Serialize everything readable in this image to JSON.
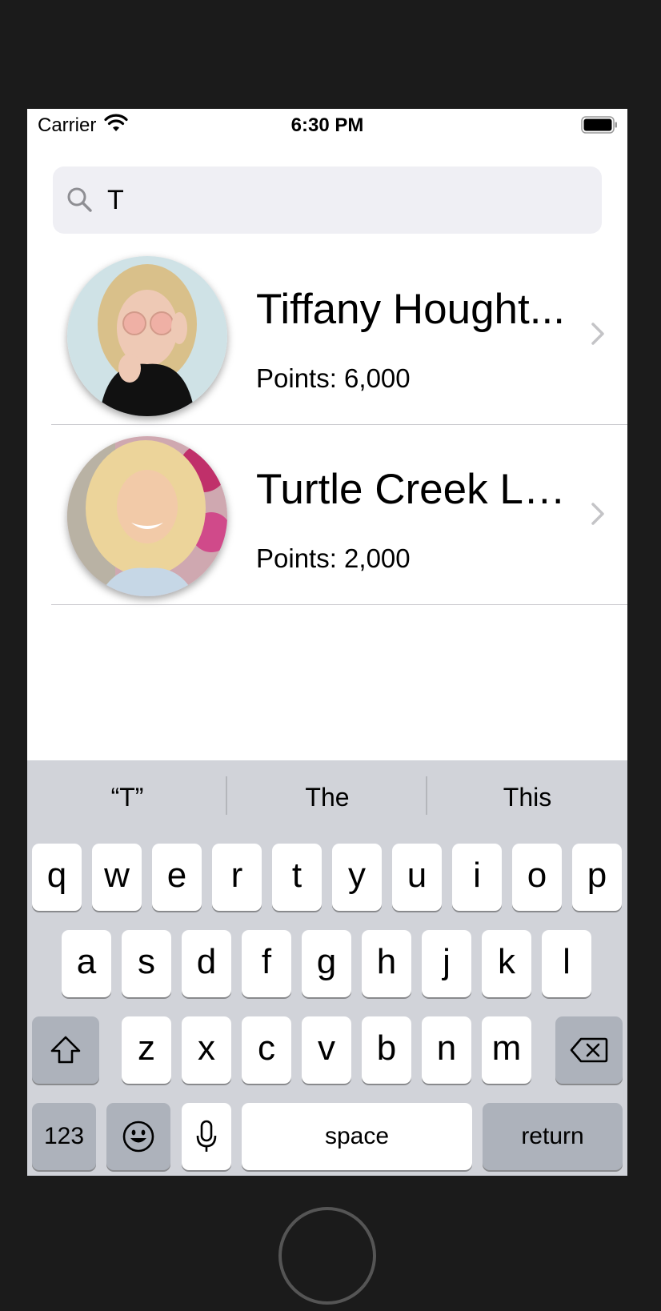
{
  "status_bar": {
    "carrier": "Carrier",
    "time": "6:30 PM",
    "icons": [
      "wifi-icon",
      "battery-icon"
    ]
  },
  "search": {
    "value": "T",
    "placeholder": "",
    "icon": "search-icon"
  },
  "results": [
    {
      "name": "Tiffany Hought...",
      "points": "Points: 6,000",
      "icon": "chevron-right-icon"
    },
    {
      "name": "Turtle Creek La...",
      "points": "Points: 2,000",
      "icon": "chevron-right-icon"
    }
  ],
  "keyboard": {
    "suggestions": [
      "“T”",
      "The",
      "This"
    ],
    "row1": [
      "q",
      "w",
      "e",
      "r",
      "t",
      "y",
      "u",
      "i",
      "o",
      "p"
    ],
    "row2": [
      "a",
      "s",
      "d",
      "f",
      "g",
      "h",
      "j",
      "k",
      "l"
    ],
    "row3": [
      "z",
      "x",
      "c",
      "v",
      "b",
      "n",
      "m"
    ],
    "numbers_label": "123",
    "space_label": "space",
    "return_label": "return",
    "icons": [
      "shift-icon",
      "delete-icon",
      "emoji-icon",
      "microphone-icon"
    ]
  },
  "colors": {
    "keyboard_bg": "#d1d3d9",
    "key_bg": "#ffffff",
    "function_key_bg": "#adb2bb",
    "search_bg": "#efeff4"
  }
}
